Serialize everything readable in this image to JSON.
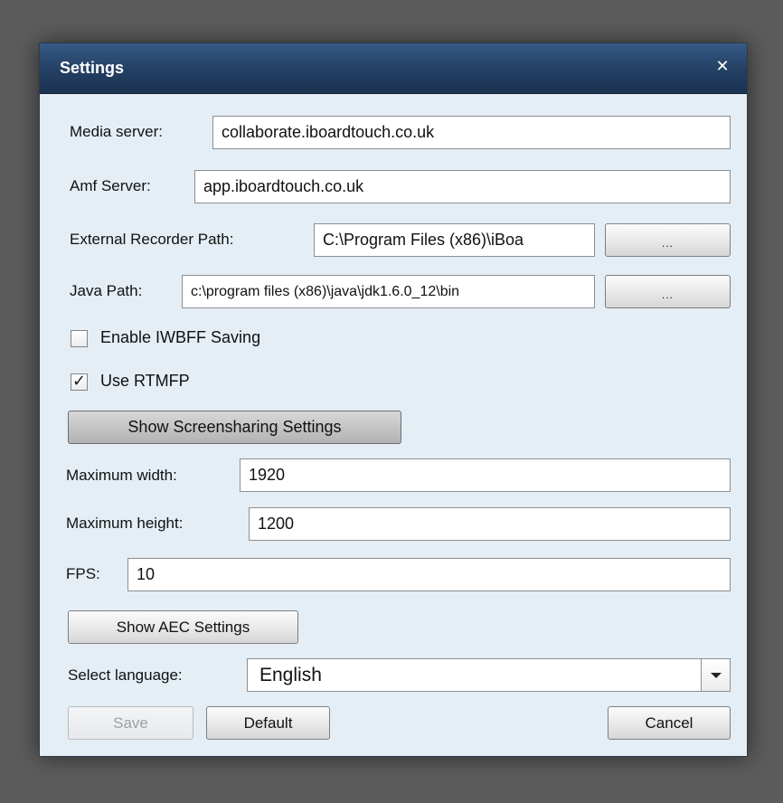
{
  "dialog": {
    "title": "Settings",
    "close_glyph": "✕"
  },
  "fields": {
    "media_server": {
      "label": "Media server:",
      "value": "collaborate.iboardtouch.co.uk"
    },
    "amf_server": {
      "label": "Amf Server:",
      "value": "app.iboardtouch.co.uk"
    },
    "external_recorder_path": {
      "label": "External Recorder Path:",
      "value": "C:\\Program Files (x86)\\iBoa"
    },
    "java_path": {
      "label": "Java Path:",
      "value": "c:\\program files (x86)\\java\\jdk1.6.0_12\\bin"
    },
    "max_width": {
      "label": "Maximum width:",
      "value": "1920"
    },
    "max_height": {
      "label": "Maximum height:",
      "value": "1200"
    },
    "fps": {
      "label": "FPS:",
      "value": "10"
    }
  },
  "browse_label": "...",
  "checkboxes": {
    "enable_iwbff": {
      "label": "Enable IWBFF Saving",
      "checked": false
    },
    "use_rtmfp": {
      "label": "Use RTMFP",
      "checked": true,
      "mark": "✓"
    }
  },
  "buttons": {
    "show_screensharing": "Show Screensharing Settings",
    "show_aec": "Show AEC Settings",
    "save": "Save",
    "default": "Default",
    "cancel": "Cancel"
  },
  "language": {
    "label": "Select language:",
    "selected": "English"
  },
  "icons": {
    "close": "close-icon",
    "dropdown": "chevron-down-icon",
    "check": "checkmark-icon"
  },
  "colors": {
    "titlebar": "#233f62",
    "dialog_bg": "#e5eef5",
    "backdrop": "#5c5c5c"
  }
}
